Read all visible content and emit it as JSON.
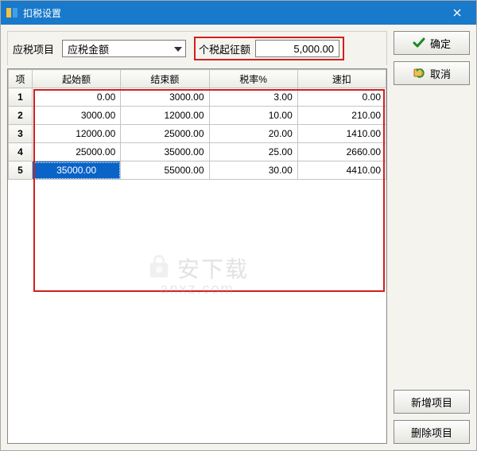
{
  "window": {
    "title": "扣税设置"
  },
  "toprow": {
    "item_label": "应税项目",
    "item_combo": "应税金额",
    "threshold_label": "个税起征额",
    "threshold_value": "5,000.00"
  },
  "buttons": {
    "ok": "确定",
    "cancel": "取消",
    "add": "新增项目",
    "delete": "删除项目"
  },
  "table": {
    "headers": {
      "idx": "项",
      "start": "起始额",
      "end": "结束额",
      "rate": "税率%",
      "quick": "速扣"
    },
    "rows": [
      {
        "idx": "1",
        "start": "0.00",
        "end": "3000.00",
        "rate": "3.00",
        "quick": "0.00",
        "sel": false
      },
      {
        "idx": "2",
        "start": "3000.00",
        "end": "12000.00",
        "rate": "10.00",
        "quick": "210.00",
        "sel": false
      },
      {
        "idx": "3",
        "start": "12000.00",
        "end": "25000.00",
        "rate": "20.00",
        "quick": "1410.00",
        "sel": false
      },
      {
        "idx": "4",
        "start": "25000.00",
        "end": "35000.00",
        "rate": "25.00",
        "quick": "2660.00",
        "sel": false
      },
      {
        "idx": "5",
        "start": "35000.00",
        "end": "55000.00",
        "rate": "30.00",
        "quick": "4410.00",
        "sel": true
      }
    ]
  },
  "watermark": {
    "text": "安下载",
    "sub": "anxz.com"
  },
  "icons": {
    "app": "app-icon",
    "close": "close-icon",
    "ok": "check-icon",
    "cancel": "undo-icon"
  },
  "colors": {
    "titlebar": "#1979ca",
    "highlight_border": "#d21f1f",
    "selection": "#0a63c6"
  }
}
